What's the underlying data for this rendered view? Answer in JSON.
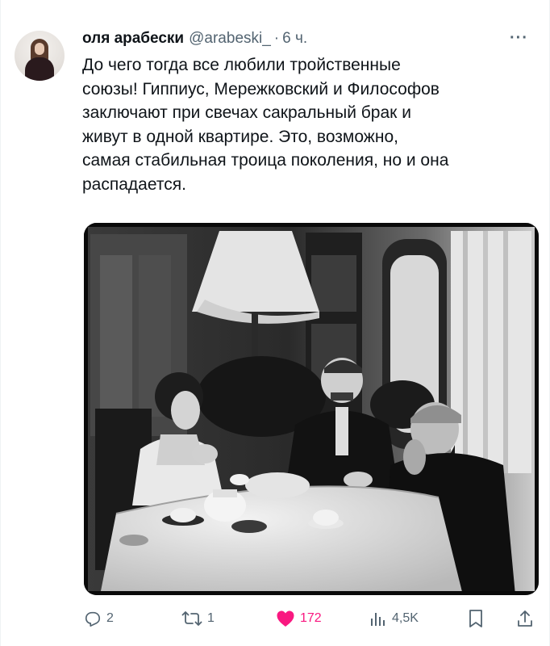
{
  "tweet": {
    "display_name": "оля арабески",
    "handle": "@arabeski_",
    "separator": "·",
    "time": "6 ч.",
    "more_label": "···",
    "text_lines": [
      "До чего тогда все любили тройственные",
      "союзы! Гиппиус, Мережковский и Философов",
      "заключают при свечах сакральный брак и",
      "живут в одной квартире. Это, возможно,",
      "самая стабильная троица поколения, но и она",
      "распадается."
    ]
  },
  "actions": {
    "replies": "2",
    "retweets": "1",
    "likes": "172",
    "views": "4,5K"
  },
  "colors": {
    "text": "#0f1419",
    "secondary": "#536471",
    "like": "#f91880",
    "border": "#eff3f4"
  },
  "icons": [
    "reply-icon",
    "retweet-icon",
    "heart-icon",
    "views-icon",
    "bookmark-icon",
    "share-icon",
    "more-icon"
  ]
}
